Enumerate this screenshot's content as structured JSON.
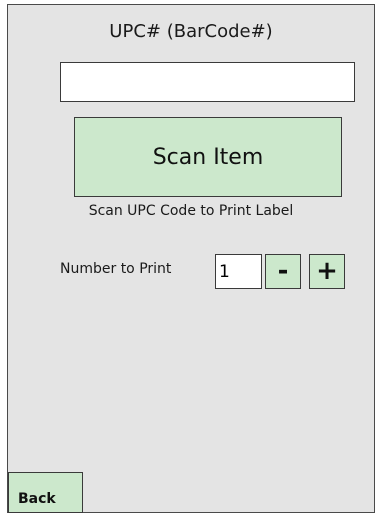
{
  "upc": {
    "title": "UPC# (BarCode#)",
    "value": ""
  },
  "scan": {
    "button_label": "Scan Item",
    "hint": "Scan UPC Code to Print Label"
  },
  "quantity": {
    "label": "Number to Print",
    "value": "1",
    "decrement_label": "-",
    "increment_label": "+"
  },
  "footer": {
    "back_label": "Back"
  },
  "colors": {
    "background": "#e4e4e4",
    "button_fill": "#cce8cc",
    "border": "#3a3a3a"
  }
}
